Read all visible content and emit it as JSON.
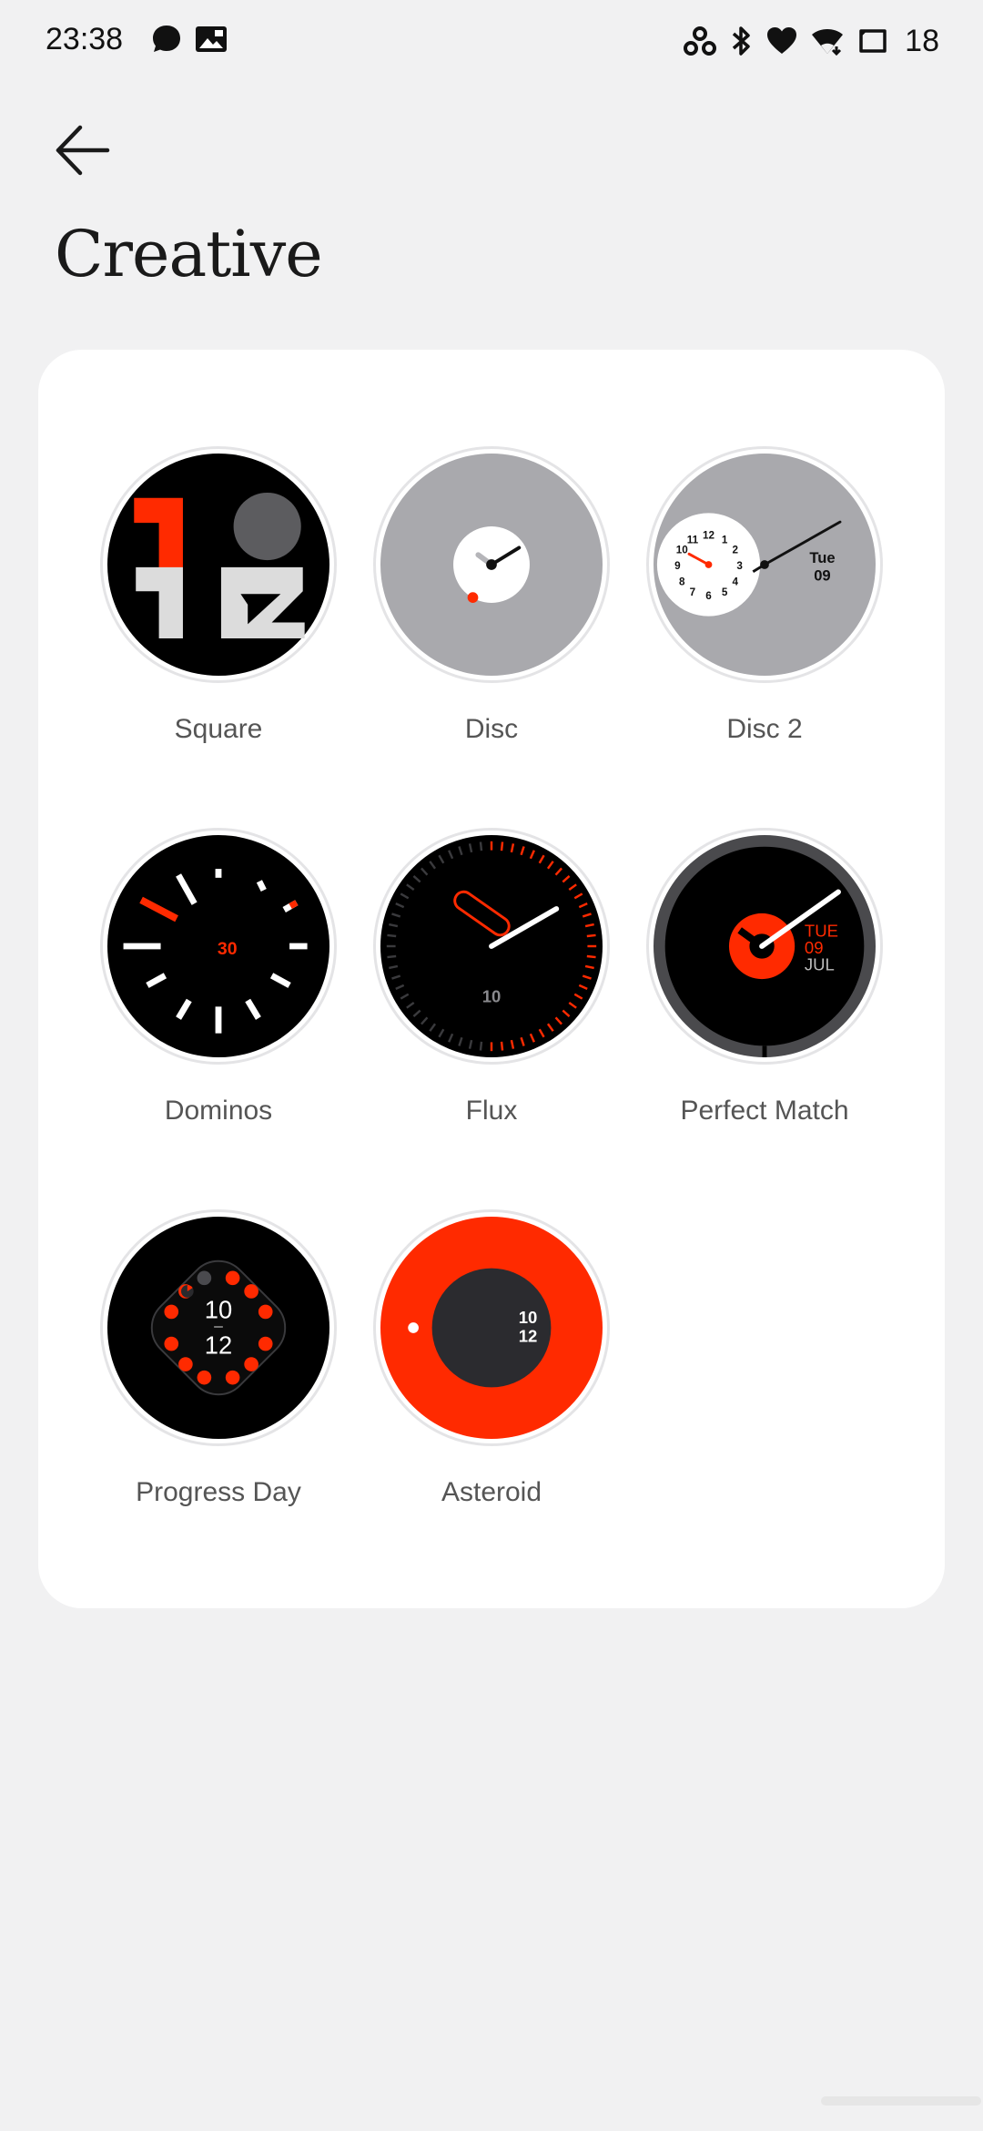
{
  "status_bar": {
    "time": "23:38",
    "left_icons": [
      "chat-bubble-icon",
      "gallery-icon"
    ],
    "right_icons": [
      "link-icon",
      "bluetooth-icon",
      "heart-icon",
      "wifi-icon",
      "screen-icon"
    ],
    "battery": "18"
  },
  "header": {
    "back_icon": "arrow-left-icon",
    "title": "Creative"
  },
  "faces": [
    {
      "id": "square",
      "label": "Square",
      "dial": {
        "top": "1",
        "bottom": "12"
      },
      "colors": {
        "accent": "#ff2a00",
        "bg": "#000000",
        "block": "#dcdcdc",
        "circle": "#5c5c5f"
      }
    },
    {
      "id": "disc",
      "label": "Disc",
      "colors": {
        "bg": "#a9a9ad",
        "disc": "#ffffff",
        "dot": "#ff2a00"
      }
    },
    {
      "id": "disc-2",
      "label": "Disc 2",
      "dial_numbers": [
        "12",
        "1",
        "2",
        "3",
        "4",
        "5",
        "6",
        "7",
        "8",
        "9",
        "10",
        "11"
      ],
      "day": "Tue",
      "date": "09",
      "colors": {
        "bg": "#a9a9ad",
        "disc": "#ffffff",
        "hand": "#ff2a00"
      }
    },
    {
      "id": "dominos",
      "label": "Dominos",
      "seconds": "30",
      "colors": {
        "bg": "#000000",
        "accent": "#ff2a00"
      }
    },
    {
      "id": "flux",
      "label": "Flux",
      "date": "10",
      "colors": {
        "bg": "#000000",
        "accent": "#ff2a00"
      }
    },
    {
      "id": "perfect-match",
      "label": "Perfect Match",
      "day": "TUE",
      "date": "09",
      "month": "JUL",
      "colors": {
        "bg": "#000000",
        "accent": "#ff2a00",
        "ring": "#4a4a4d"
      }
    },
    {
      "id": "progress-day",
      "label": "Progress Day",
      "hour": "10",
      "minute": "12",
      "colors": {
        "bg": "#000000",
        "accent": "#ff2a00"
      }
    },
    {
      "id": "asteroid",
      "label": "Asteroid",
      "hour": "10",
      "minute": "12",
      "colors": {
        "bg": "#ff2a00",
        "inner": "#2b2b2f"
      }
    }
  ]
}
